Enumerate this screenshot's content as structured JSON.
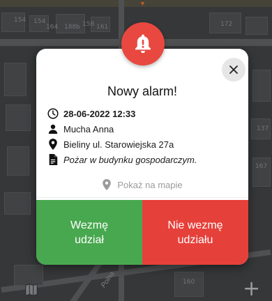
{
  "dialog": {
    "title": "Nowy alarm!",
    "datetime": "28-06-2022 12:33",
    "person": "Mucha Anna",
    "address": "Bieliny ul. Starowiejska 27a",
    "description": "Pożar w budynku gospodarczym.",
    "show_on_map_label": "Pokaż na mapie",
    "accept_label": "Wezmę\nudział",
    "decline_label": "Nie wezmę\nudziału"
  },
  "icons": {
    "alarm": "bell-icon",
    "close": "close-icon",
    "time": "clock-icon",
    "person": "person-icon",
    "location": "location-pin-icon",
    "description": "document-icon",
    "map": "map-icon",
    "add": "plus-icon"
  },
  "colors": {
    "alarm_red": "#e8483f",
    "accept_green": "#48a84f",
    "decline_red": "#e6403a",
    "muted_gray": "#9b9b9b"
  },
  "map": {
    "labels": [
      "154",
      "154",
      "164",
      "188b",
      "158",
      "161",
      "172",
      "137",
      "167",
      "160"
    ],
    "street": "Polna",
    "plus": "+"
  }
}
